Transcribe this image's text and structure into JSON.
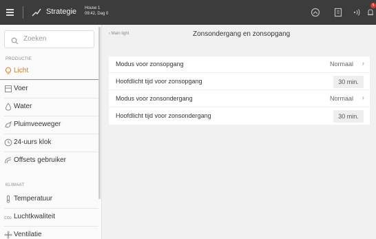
{
  "topbar": {
    "strategy_label": "Strategie",
    "house_name": "House 1",
    "time_day": "09:42, Dag 0",
    "notification_count": "5"
  },
  "sidebar": {
    "search_placeholder": "Zoeken",
    "sections": [
      {
        "label": "PRODUCTIE",
        "items": [
          {
            "label": "Licht",
            "icon": "lightbulb-icon",
            "active": true
          },
          {
            "label": "Voer",
            "icon": "feed-icon"
          },
          {
            "label": "Water",
            "icon": "water-drop-icon"
          },
          {
            "label": "Pluimveeweger",
            "icon": "bird-weigher-icon"
          },
          {
            "label": "24-uurs klok",
            "icon": "clock-icon"
          },
          {
            "label": "Offsets gebruiker",
            "icon": "offsets-icon"
          }
        ]
      },
      {
        "label": "KLIMAAT",
        "items": [
          {
            "label": "Temperatuur",
            "icon": "thermometer-icon"
          },
          {
            "label": "Luchtkwaliteit",
            "icon": "co2-icon"
          },
          {
            "label": "Ventilatie",
            "icon": "fan-icon"
          }
        ]
      }
    ]
  },
  "main": {
    "breadcrumb": "Main light",
    "title": "Zonsondergang en zonsopgang",
    "rows": [
      {
        "label": "Modus voor zonsopgang",
        "value": "Normaal",
        "type": "select"
      },
      {
        "label": "Hoofdlicht tijd voor zonsopgang",
        "value": "30 min.",
        "type": "input"
      },
      {
        "label": "Modus voor zonsondergang",
        "value": "Normaal",
        "type": "select"
      },
      {
        "label": "Hoofdlicht tijd voor zonsondergang",
        "value": "30 min.",
        "type": "input"
      }
    ]
  },
  "colors": {
    "accent": "#e07a1f",
    "topbar": "#3c3c3c",
    "badge": "#d23a2a"
  }
}
